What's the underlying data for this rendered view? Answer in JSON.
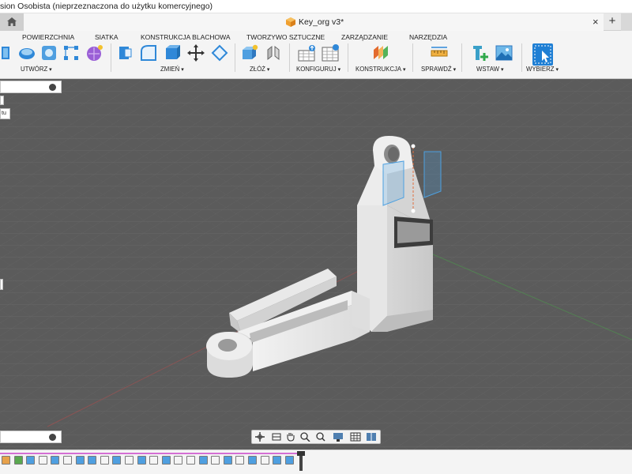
{
  "window": {
    "title": "sion Osobista (nieprzeznaczona do użytku komercyjnego)"
  },
  "tabs": {
    "document_title": "Key_org v3*",
    "close_symbol": "×",
    "new_tab_symbol": "+"
  },
  "ribbon": {
    "tabs": [
      "POWIERZCHNIA",
      "SIATKA",
      "KONSTRUKCJA BLACHOWA",
      "TWORZYWO SZTUCZNE",
      "ZARZĄDZANIE",
      "NARZĘDZIA"
    ],
    "groups": [
      "UTWÓRZ",
      "ZMIEŃ",
      "ZŁÓŻ",
      "KONFIGURUJ",
      "KONSTRUKCJA",
      "SPRAWDŹ",
      "WSTAW",
      "WYBIERZ"
    ]
  },
  "panels": {
    "stub_text": "tu"
  },
  "colors": {
    "accent_blue": "#1f7fd4",
    "viewport_bg": "#5b5b5b",
    "timeline_progress": "#d46fd4",
    "model_body": "#eeeeee"
  },
  "icons": {
    "home": "home-icon",
    "document": "fusion-document-icon",
    "navigation": [
      "orbit-icon",
      "pan-look-icon",
      "hand-pan-icon",
      "zoom-icon",
      "zoom-window-icon",
      "display-settings-icon",
      "grid-settings-icon",
      "viewports-icon"
    ]
  }
}
